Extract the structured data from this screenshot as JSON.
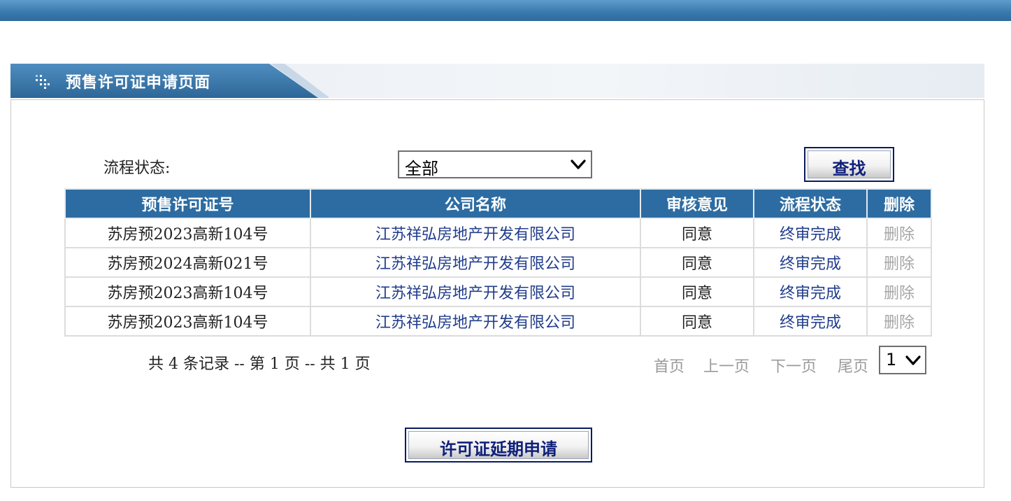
{
  "header": {
    "title": "预售许可证申请页面",
    "icon": "dots-grid-icon"
  },
  "filter": {
    "label": "流程状态:",
    "selected": "全部"
  },
  "search_button": "查找",
  "table": {
    "columns": [
      "预售许可证号",
      "公司名称",
      "审核意见",
      "流程状态",
      "删除"
    ],
    "rows": [
      [
        "苏房预2023高新104号",
        "江苏祥弘房地产开发有限公司",
        "同意",
        "终审完成",
        "删除"
      ],
      [
        "苏房预2024高新021号",
        "江苏祥弘房地产开发有限公司",
        "同意",
        "终审完成",
        "删除"
      ],
      [
        "苏房预2023高新104号",
        "江苏祥弘房地产开发有限公司",
        "同意",
        "终审完成",
        "删除"
      ],
      [
        "苏房预2023高新104号",
        "江苏祥弘房地产开发有限公司",
        "同意",
        "终审完成",
        "删除"
      ]
    ]
  },
  "pager": {
    "summary": "共 4 条记录 -- 第 1 页 -- 共 1 页",
    "first": "首页",
    "prev": "上一页",
    "next": "下一页",
    "last": "尾页",
    "page_selected": "1"
  },
  "extend_button": "许可证延期申请",
  "colors": {
    "header_blue": "#2d6ca2",
    "link_blue": "#213d8c",
    "disabled_gray": "#a6a6a6"
  }
}
